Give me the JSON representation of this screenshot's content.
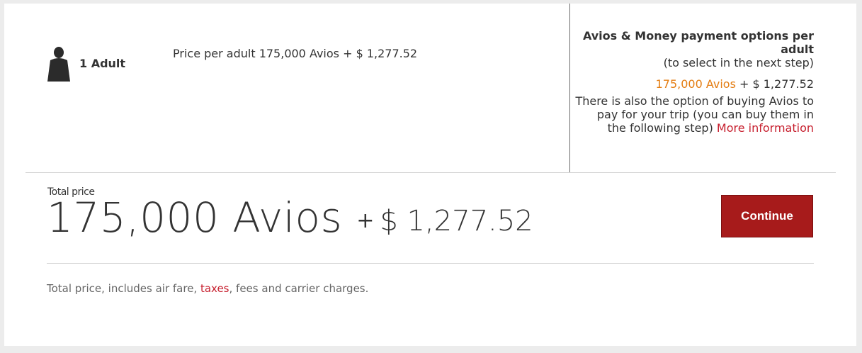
{
  "passenger": {
    "icon": "person-icon",
    "label": "1 Adult"
  },
  "price_per_adult": "Price per adult 175,000 Avios + $ 1,277.52",
  "payment_options": {
    "title": "Avios & Money payment options per adult",
    "subtitle": "(to select in the next step)",
    "avios": "175,000 Avios",
    "plus_money": " + $ 1,277.52",
    "info_text": "There is also the option of buying Avios to pay for your trip (you can buy them in the following step) ",
    "more_info_link": "More information"
  },
  "total": {
    "label": "Total price",
    "avios": "175,000 Avios",
    "plus": "+",
    "money": "$ 1,277.52"
  },
  "continue_label": "Continue",
  "footnote": {
    "before": "Total price, includes air fare, ",
    "taxes_link": "taxes",
    "after": ", fees and carrier charges."
  },
  "colors": {
    "accent_red": "#a71b1b",
    "link_red": "#c7202f",
    "avios_orange": "#e47d12"
  }
}
